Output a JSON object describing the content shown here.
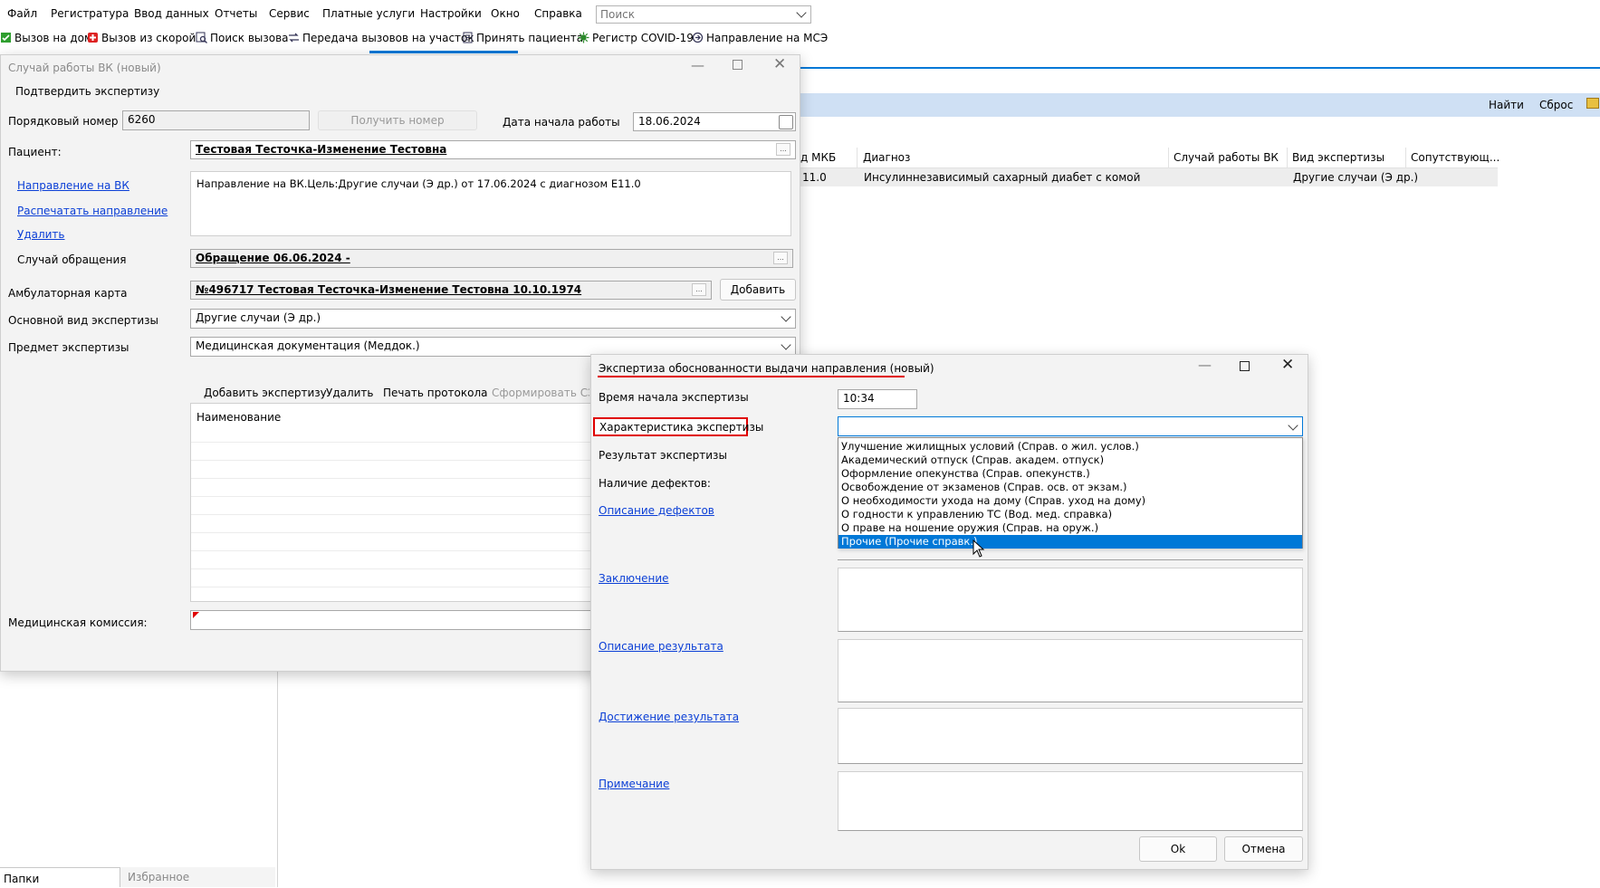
{
  "menu": [
    "Файл",
    "Регистратура",
    "Ввод данных",
    "Отчеты",
    "Сервис",
    "Платные услуги",
    "Настройки",
    "Окно",
    "Справка"
  ],
  "search": {
    "placeholder": "Поиск"
  },
  "toolbar": [
    {
      "label": "Вызов на дом",
      "icon": "house-call-icon",
      "color": "#2e9e2e"
    },
    {
      "label": "Вызов из скорой",
      "icon": "ambulance-icon",
      "color": "#d22"
    },
    {
      "label": "Поиск вызова",
      "icon": "search-call-icon",
      "color": "#335"
    },
    {
      "label": "Передача вызовов на участок",
      "icon": "transfer-icon",
      "color": "#335"
    },
    {
      "label": "Принять пациента",
      "icon": "accept-patient-icon",
      "color": "#335"
    },
    {
      "label": "Регистр COVID-19",
      "icon": "covid-icon",
      "color": "#2a8a2a"
    },
    {
      "label": "Направление на МСЭ",
      "icon": "mse-icon",
      "color": "#335"
    }
  ],
  "bg": {
    "find_btn": "Найти",
    "reset_btn": "Сброс",
    "columns": [
      "д МКБ",
      "Диагноз",
      "Случай работы ВК",
      "Вид экспертизы",
      "Сопутствующ..."
    ],
    "row": {
      "code": "11.0",
      "diagnosis": "Инсулиннезависимый сахарный диабет с комой",
      "expertise": "Другие случаи (Э др.)"
    },
    "tabs": {
      "folders": "Папки",
      "favorites": "Избранное"
    }
  },
  "vk": {
    "title": "Случай работы ВК (новый)",
    "confirm": "Подтвердить экспертизу",
    "order_label": "Порядковый номер",
    "order_value": "6260",
    "get_number": "Получить номер",
    "start_date_label": "Дата начала работы",
    "start_date": "18.06.2024",
    "patient_label": "Пациент:",
    "patient": "Тестовая Тесточка-Изменение Тестовна",
    "link_direction": "Направление на ВК",
    "link_print": "Распечатать направление",
    "link_delete": "Удалить",
    "direction_text": "Направление на ВК.Цель:Другие случаи (Э др.) от 17.06.2024 с диагнозом E11.0",
    "case_label": "Случай обращения",
    "case_value": "Обращение 06.06.2024 -",
    "card_label": "Амбулаторная карта",
    "card_value": "№496717 Тестовая Тесточка-Изменение Тестовна 10.10.1974",
    "add": "Добавить",
    "main_type_label": "Основной вид экспертизы",
    "main_type": "Другие случаи (Э др.)",
    "subject_label": "Предмет экспертизы",
    "subject": "Медицинская документация (Меддок.)",
    "tb_add": "Добавить экспертизу",
    "tb_delete": "Удалить",
    "tb_print": "Печать протокола",
    "tb_form": "Сформировать СЭМД",
    "col_name": "Наименование",
    "commission_label": "Медицинская комиссия:"
  },
  "exp": {
    "title": "Экспертиза обоснованности выдачи направления (новый)",
    "time_label": "Время начала экспертизы",
    "time": "10:34",
    "char_label": "Характеристика экспертизы",
    "result_label": "Результат экспертизы",
    "defects_label": "Наличие дефектов:",
    "link_defects": "Описание дефектов",
    "link_conclusion": "Заключение",
    "link_result_desc": "Описание результата",
    "link_achieve": "Достижение результата",
    "link_note": "Примечание",
    "ok": "Ok",
    "cancel": "Отмена",
    "options": [
      "Улучшение жилищных условий (Справ. о жил. услов.)",
      "Академический отпуск (Справ. академ. отпуск)",
      "Оформление опекунства (Справ. опекунств.)",
      "Освобождение от экзаменов (Справ. осв. от экзам.)",
      "О необходимости ухода на дому (Справ. уход на дому)",
      "О годности к управлению ТС (Вод. мед. справка)",
      "О праве на ношение оружия (Справ. на оруж.)",
      "Прочие (Прочие справк.)"
    ],
    "selected_index": 7
  },
  "colors": {
    "accent": "#0078d7",
    "highlight_red": "#e00000",
    "link": "#0b3fd6",
    "band": "#cfe0f4"
  }
}
